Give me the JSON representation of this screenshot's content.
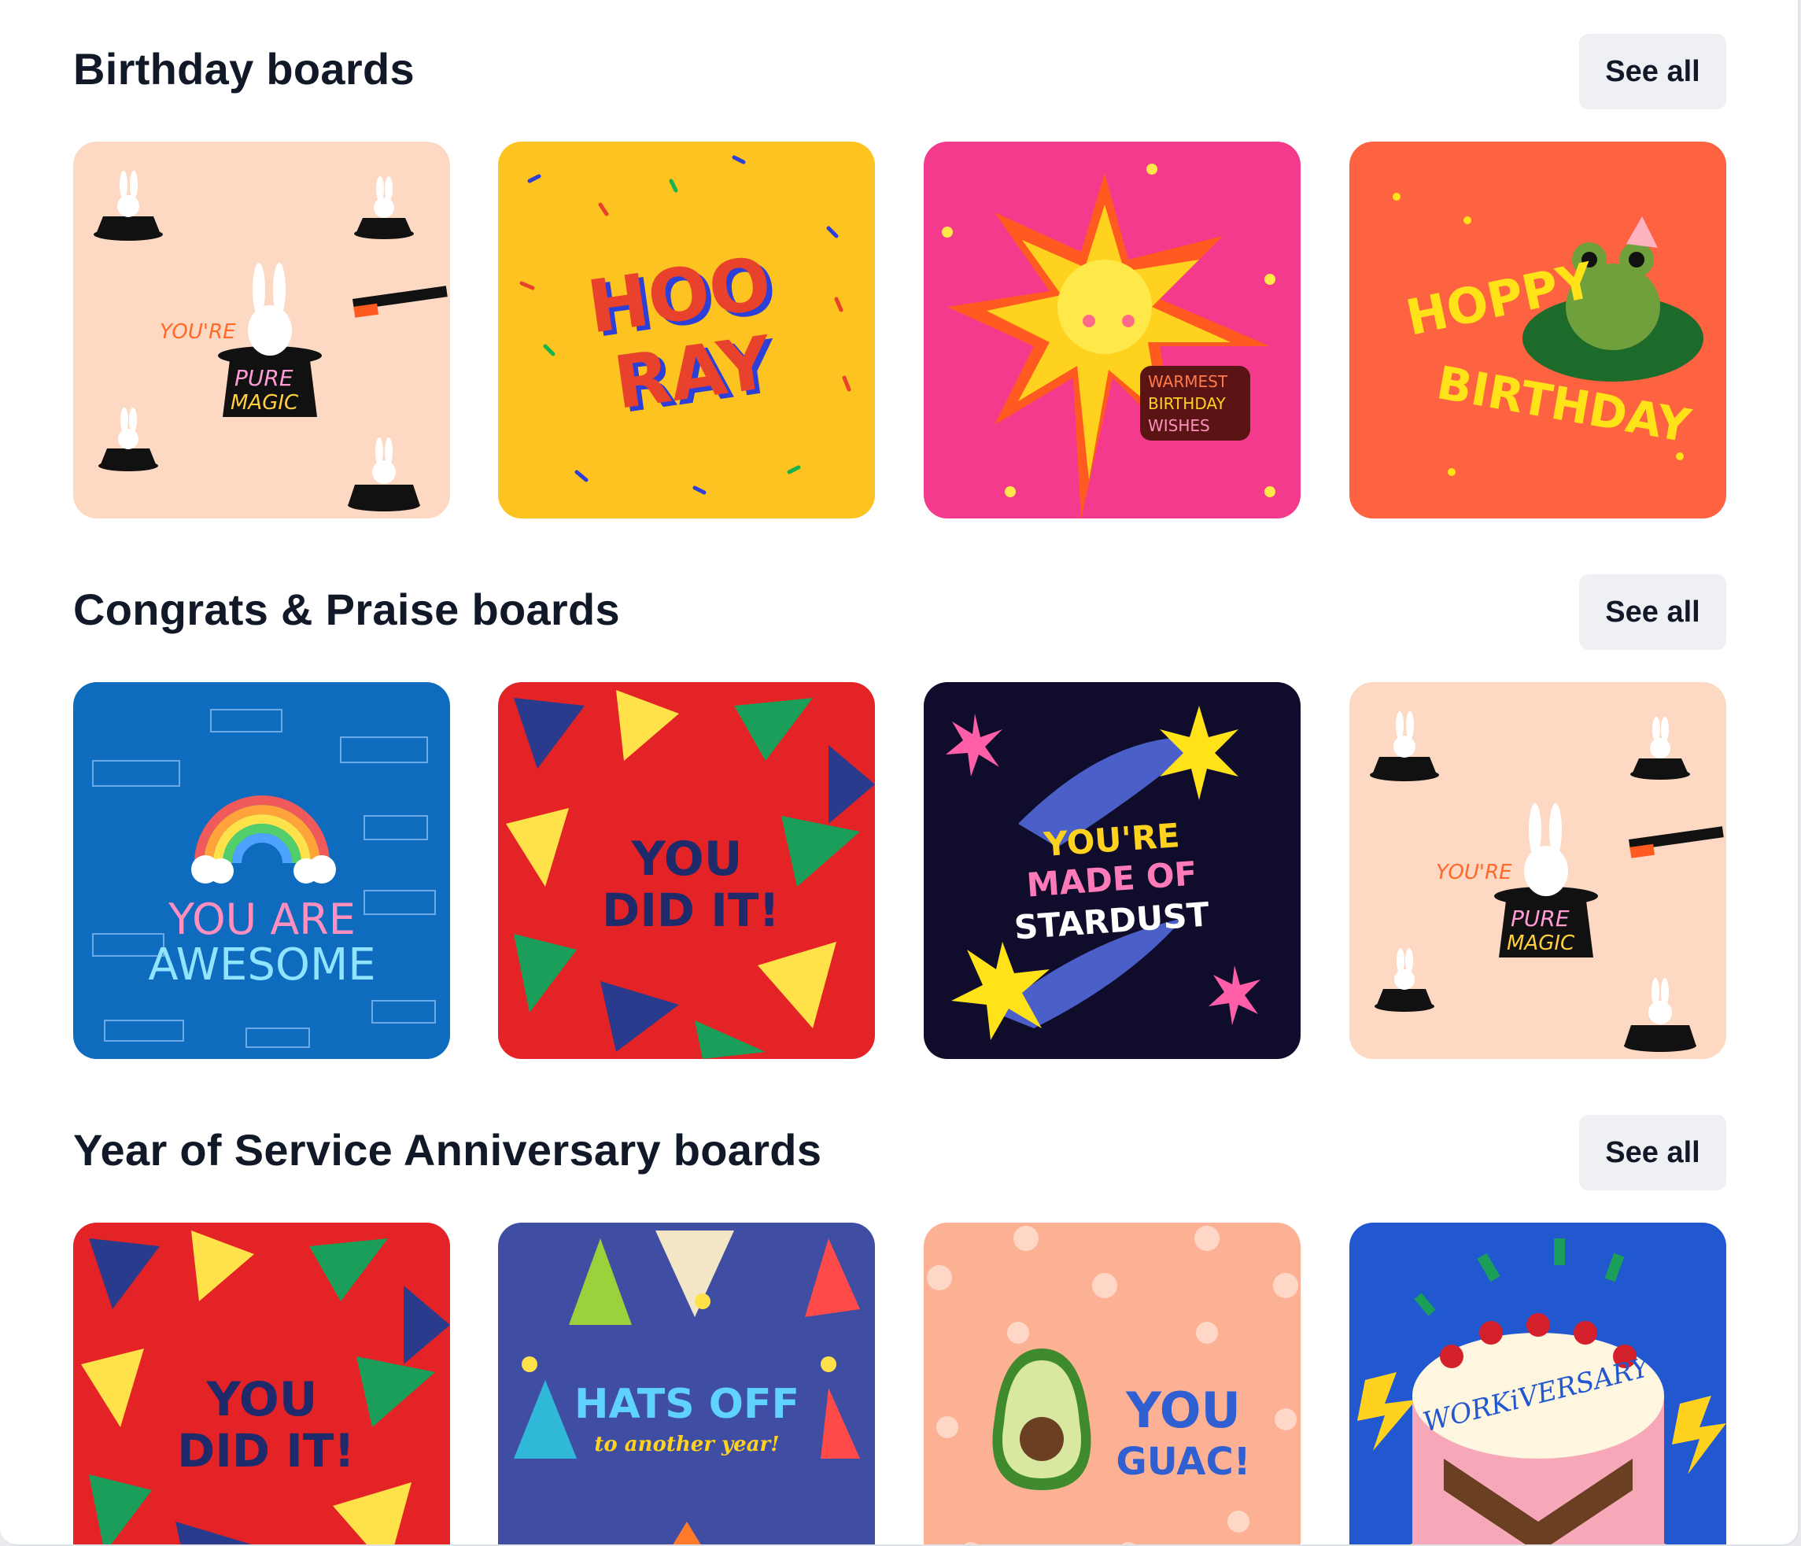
{
  "sections": [
    {
      "title": "Birthday boards",
      "see_all": "See all",
      "cards": [
        {
          "texts": [
            "YOU'RE",
            "PURE",
            "MAGIC"
          ],
          "icon": "magic-hat-bunnies",
          "bg": "#fdd9c3"
        },
        {
          "texts": [
            "HOO",
            "RAY"
          ],
          "icon": "confetti",
          "bg": "#fcc321"
        },
        {
          "texts": [
            "WARMEST",
            "BIRTHDAY",
            "WISHES"
          ],
          "icon": "sunburst",
          "bg": "#f43a8c"
        },
        {
          "texts": [
            "HOPPY",
            "BIRTHDAY"
          ],
          "icon": "frog",
          "bg": "#fe6341"
        }
      ]
    },
    {
      "title": "Congrats & Praise boards",
      "see_all": "See all",
      "cards": [
        {
          "texts": [
            "YOU ARE",
            "AWESOME"
          ],
          "icon": "rainbow",
          "bg": "#0f6bbd"
        },
        {
          "texts": [
            "YOU",
            "DID IT!"
          ],
          "icon": "pennants",
          "bg": "#e42327"
        },
        {
          "texts": [
            "YOU'RE",
            "MADE OF",
            "STARDUST"
          ],
          "icon": "shooting-star",
          "bg": "#0f0d2b"
        },
        {
          "texts": [
            "YOU'RE",
            "PURE",
            "MAGIC"
          ],
          "icon": "magic-hat-bunnies",
          "bg": "#fdd9c3"
        }
      ]
    },
    {
      "title": "Year of Service Anniversary boards",
      "see_all": "See all",
      "cards": [
        {
          "texts": [
            "YOU",
            "DID IT!"
          ],
          "icon": "pennants",
          "bg": "#e42327"
        },
        {
          "texts": [
            "HATS OFF",
            "to another year!"
          ],
          "icon": "party-hats",
          "bg": "#3f4ea3"
        },
        {
          "texts": [
            "YOU",
            "GUAC!"
          ],
          "icon": "avocado",
          "bg": "#fcb195"
        },
        {
          "texts": [
            "WORKiVERSARY"
          ],
          "icon": "cake",
          "bg": "#2157cf"
        }
      ]
    }
  ]
}
